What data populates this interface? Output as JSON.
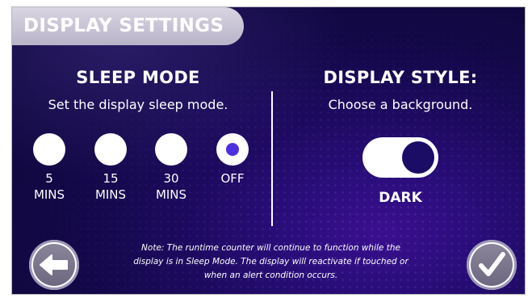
{
  "header": {
    "title": "DISPLAY SETTINGS"
  },
  "sleep_mode": {
    "title": "SLEEP MODE",
    "subtitle": "Set the display sleep mode.",
    "options": [
      {
        "line1": "5",
        "line2": "MINS",
        "selected": false
      },
      {
        "line1": "15",
        "line2": "MINS",
        "selected": false
      },
      {
        "line1": "30",
        "line2": "MINS",
        "selected": false
      },
      {
        "line1": "OFF",
        "line2": "",
        "selected": true
      }
    ]
  },
  "display_style": {
    "title": "DISPLAY STYLE:",
    "subtitle": "Choose a background.",
    "toggle_state": "DARK"
  },
  "footer": {
    "note": "Note: The runtime counter will continue to function while the display is in Sleep Mode. The display will reactivate if touched or when an alert condition occurs.",
    "back_icon": "arrow-left-icon",
    "confirm_icon": "checkmark-icon"
  },
  "colors": {
    "background": "#130847",
    "radio_selected": "#4b2fe0",
    "toggle_knob": "#1b0d66",
    "text": "#ffffff"
  }
}
